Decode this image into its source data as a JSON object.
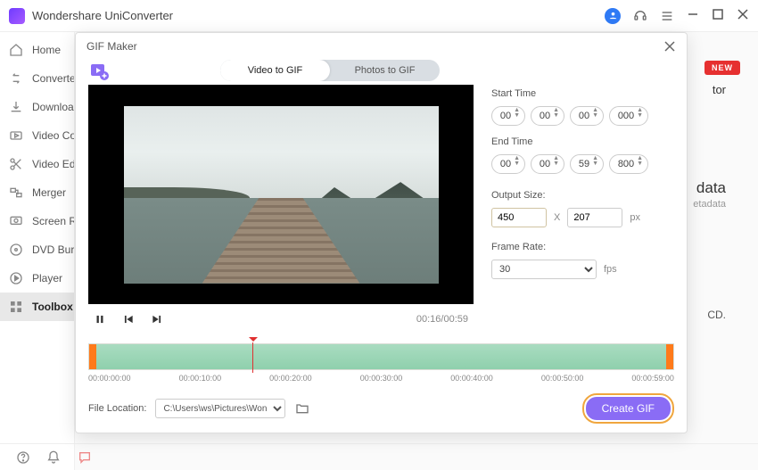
{
  "app": {
    "title": "Wondershare UniConverter"
  },
  "sidebar": {
    "items": [
      {
        "label": "Home"
      },
      {
        "label": "Converter"
      },
      {
        "label": "Downloader"
      },
      {
        "label": "Video Compressor"
      },
      {
        "label": "Video Editor"
      },
      {
        "label": "Merger"
      },
      {
        "label": "Screen Recorder"
      },
      {
        "label": "DVD Burner"
      },
      {
        "label": "Player"
      },
      {
        "label": "Toolbox"
      }
    ]
  },
  "background": {
    "new": "NEW",
    "frag1": "tor",
    "frag2": "data",
    "frag3": "etadata",
    "frag4": "CD."
  },
  "modal": {
    "title": "GIF Maker",
    "tabs": {
      "video": "Video to GIF",
      "photos": "Photos to GIF"
    },
    "transport": {
      "timecode": "00:16/00:59"
    },
    "settings": {
      "start_label": "Start Time",
      "end_label": "End Time",
      "start": {
        "h": "00",
        "m": "00",
        "s": "00",
        "ms": "000"
      },
      "end": {
        "h": "00",
        "m": "00",
        "s": "59",
        "ms": "800"
      },
      "output_label": "Output Size:",
      "width": "450",
      "x": "X",
      "height": "207",
      "px": "px",
      "framerate_label": "Frame Rate:",
      "framerate": "30",
      "fps": "fps"
    },
    "timeline": {
      "ticks": [
        "00:00:00:00",
        "00:00:10:00",
        "00:00:20:00",
        "00:00:30:00",
        "00:00:40:00",
        "00:00:50:00",
        "00:00:59:00"
      ]
    },
    "footer": {
      "location_label": "File Location:",
      "path": "C:\\Users\\ws\\Pictures\\Wonders",
      "create": "Create GIF"
    }
  }
}
